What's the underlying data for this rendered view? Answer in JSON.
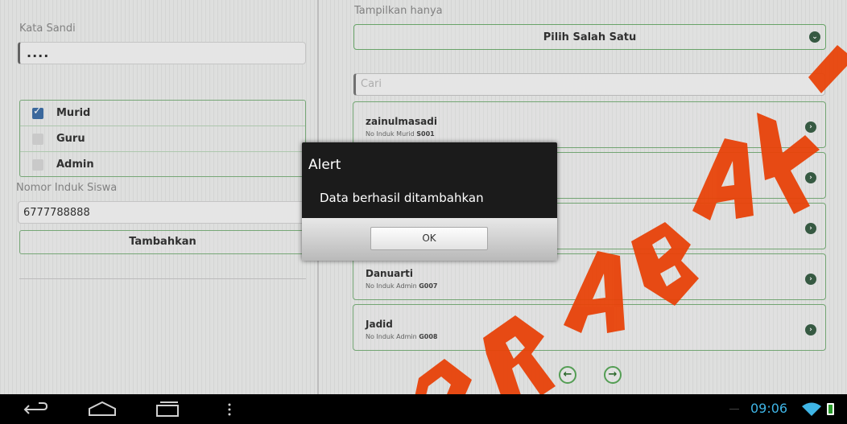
{
  "form": {
    "password_label": "Kata Sandi",
    "password_value": "....",
    "roles": [
      {
        "label": "Murid",
        "checked": true
      },
      {
        "label": "Guru",
        "checked": false
      },
      {
        "label": "Admin",
        "checked": false
      }
    ],
    "nis_label": "Nomor Induk Siswa",
    "nis_value": "6777788888",
    "add_button": "Tambahkan"
  },
  "filter": {
    "label": "Tampilkan hanya",
    "selected": "Pilih Salah Satu",
    "search_placeholder": "Cari"
  },
  "list": [
    {
      "name": "zainulmasadi",
      "sub_prefix": "No Induk Murid ",
      "sub_code": "S001"
    },
    {
      "name": "Danuarti",
      "sub_prefix": "No Induk Admin ",
      "sub_code": "G007"
    },
    {
      "name": "Jadid",
      "sub_prefix": "No Induk Admin ",
      "sub_code": "G008"
    }
  ],
  "dialog": {
    "title": "Alert",
    "message": "Data berhasil ditambahkan",
    "ok_label": "OK"
  },
  "status": {
    "time": "09:06"
  },
  "colors": {
    "accent_green": "#7bb07b",
    "clock_blue": "#3fb5e6",
    "watermark": "#e8430a"
  },
  "icons": {
    "nav": [
      "back-icon",
      "home-icon",
      "recent-apps-icon",
      "menu-icon"
    ],
    "status": [
      "wifi-icon",
      "battery-icon"
    ],
    "pager": [
      "arrow-left-icon",
      "arrow-right-icon"
    ]
  }
}
